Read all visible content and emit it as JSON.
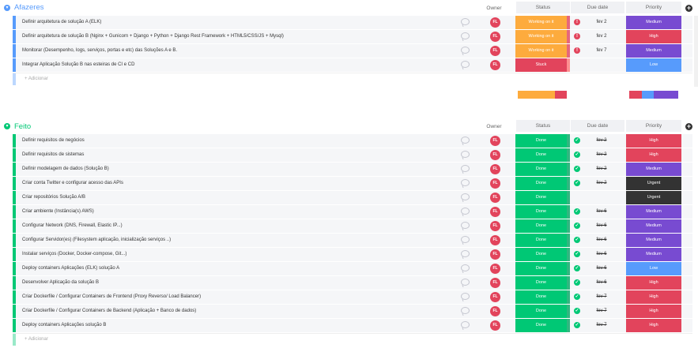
{
  "colors": {
    "blue_group": "#579bfc",
    "green_group": "#00c875",
    "working": "#fdab3d",
    "stuck": "#e2445c",
    "done": "#00c875",
    "medium": "#784bd1",
    "high": "#e2445c",
    "low": "#579bfc",
    "urgent": "#333333"
  },
  "columns": {
    "owner": "Owner",
    "status": "Status",
    "due_date": "Due date",
    "priority": "Priority"
  },
  "groups": [
    {
      "title": "Afazeres",
      "toggle_icon": "chevron-down-icon",
      "add_label": "+ Adicionar",
      "rows": [
        {
          "name": "Definir arquitetura de solução A (ELK)",
          "owner": "FL",
          "status": "Working on it",
          "status_key": "working",
          "date_icon": "!",
          "date": "fev 2",
          "date_struck": false,
          "priority": "Medium",
          "priority_key": "medium"
        },
        {
          "name": "Definir arquitetura de solução B (Nginx + Gunicorn + Django + Python + Django Rest Framework + HTML5/CSS/JS + Mysql)",
          "owner": "FL",
          "status": "Working on it",
          "status_key": "working",
          "date_icon": "!",
          "date": "fev 2",
          "date_struck": false,
          "priority": "High",
          "priority_key": "high"
        },
        {
          "name": "Monitorar (Desempenho, logs, serviços, portas e etc) das Soluções A e B.",
          "owner": "FL",
          "status": "Working on it",
          "status_key": "working",
          "date_icon": "!",
          "date": "fev 7",
          "date_struck": false,
          "priority": "Medium",
          "priority_key": "medium"
        },
        {
          "name": "Integrar Aplicação Solução B nas esteiras de CI e CD",
          "owner": "FL",
          "status": "Stuck",
          "status_key": "stuck",
          "date_icon": "",
          "date": "",
          "date_struck": false,
          "priority": "Low",
          "priority_key": "low"
        }
      ]
    },
    {
      "title": "Feito",
      "toggle_icon": "chevron-down-icon",
      "add_label": "+ Adicionar",
      "rows": [
        {
          "name": "Definir requisitos de negócios",
          "owner": "FL",
          "status": "Done",
          "status_key": "done",
          "date_icon": "✓",
          "date": "fev 2",
          "date_struck": true,
          "priority": "High",
          "priority_key": "high"
        },
        {
          "name": "Definir requisitos de sistemas",
          "owner": "FL",
          "status": "Done",
          "status_key": "done",
          "date_icon": "✓",
          "date": "fev 2",
          "date_struck": true,
          "priority": "High",
          "priority_key": "high"
        },
        {
          "name": "Definir modelagem de dados (Solução B)",
          "owner": "FL",
          "status": "Done",
          "status_key": "done",
          "date_icon": "✓",
          "date": "fev 2",
          "date_struck": true,
          "priority": "Medium",
          "priority_key": "medium"
        },
        {
          "name": "Criar conta Twitter e configurar acesso das APIs",
          "owner": "FL",
          "status": "Done",
          "status_key": "done",
          "date_icon": "✓",
          "date": "fev 2",
          "date_struck": true,
          "priority": "Urgent",
          "priority_key": "urgent"
        },
        {
          "name": "Criar repositórios Solução A/B",
          "owner": "FL",
          "status": "Done",
          "status_key": "done",
          "date_icon": "",
          "date": "",
          "date_struck": false,
          "priority": "Urgent",
          "priority_key": "urgent"
        },
        {
          "name": "Criar ambiente (Instância(s) AWS)",
          "owner": "FL",
          "status": "Done",
          "status_key": "done",
          "date_icon": "✓",
          "date": "fev 6",
          "date_struck": true,
          "priority": "Medium",
          "priority_key": "medium"
        },
        {
          "name": "Configurar Network (DNS, Firewall, Elastic IP...)",
          "owner": "FL",
          "status": "Done",
          "status_key": "done",
          "date_icon": "✓",
          "date": "fev 6",
          "date_struck": true,
          "priority": "Medium",
          "priority_key": "medium"
        },
        {
          "name": "Configurar Servidor(es) (Filesystem aplicação, inicialização serviços ..)",
          "owner": "FL",
          "status": "Done",
          "status_key": "done",
          "date_icon": "✓",
          "date": "fev 6",
          "date_struck": true,
          "priority": "Medium",
          "priority_key": "medium"
        },
        {
          "name": "Instalar serviços (Docker, Docker-compose, Git...)",
          "owner": "FL",
          "status": "Done",
          "status_key": "done",
          "date_icon": "✓",
          "date": "fev 6",
          "date_struck": true,
          "priority": "Medium",
          "priority_key": "medium"
        },
        {
          "name": "Deploy containers Aplicações (ELK) solução A",
          "owner": "FL",
          "status": "Done",
          "status_key": "done",
          "date_icon": "✓",
          "date": "fev 6",
          "date_struck": true,
          "priority": "Low",
          "priority_key": "low"
        },
        {
          "name": "Desenvolver Aplicação da solução B",
          "owner": "FL",
          "status": "Done",
          "status_key": "done",
          "date_icon": "✓",
          "date": "fev 6",
          "date_struck": true,
          "priority": "High",
          "priority_key": "high"
        },
        {
          "name": "Criar Dockerfile / Configurar Containers de Frontend (Proxy Reverso/ Load Balancer)",
          "owner": "FL",
          "status": "Done",
          "status_key": "done",
          "date_icon": "✓",
          "date": "fev 7",
          "date_struck": true,
          "priority": "High",
          "priority_key": "high"
        },
        {
          "name": "Criar Dockerfile / Configurar Containers de Backend (Aplicação + Banco de dados)",
          "owner": "FL",
          "status": "Done",
          "status_key": "done",
          "date_icon": "✓",
          "date": "fev 7",
          "date_struck": true,
          "priority": "High",
          "priority_key": "high"
        },
        {
          "name": "Deploy containers Aplicações solução B",
          "owner": "FL",
          "status": "Done",
          "status_key": "done",
          "date_icon": "✓",
          "date": "fev 7",
          "date_struck": true,
          "priority": "High",
          "priority_key": "high"
        }
      ]
    }
  ],
  "summaries": {
    "status": [
      {
        "key": "working",
        "share": 0.75
      },
      {
        "key": "stuck",
        "share": 0.25
      }
    ],
    "priority": [
      {
        "key": "high",
        "share": 0.25
      },
      {
        "key": "low",
        "share": 0.25
      },
      {
        "key": "medium",
        "share": 0.5
      }
    ]
  }
}
